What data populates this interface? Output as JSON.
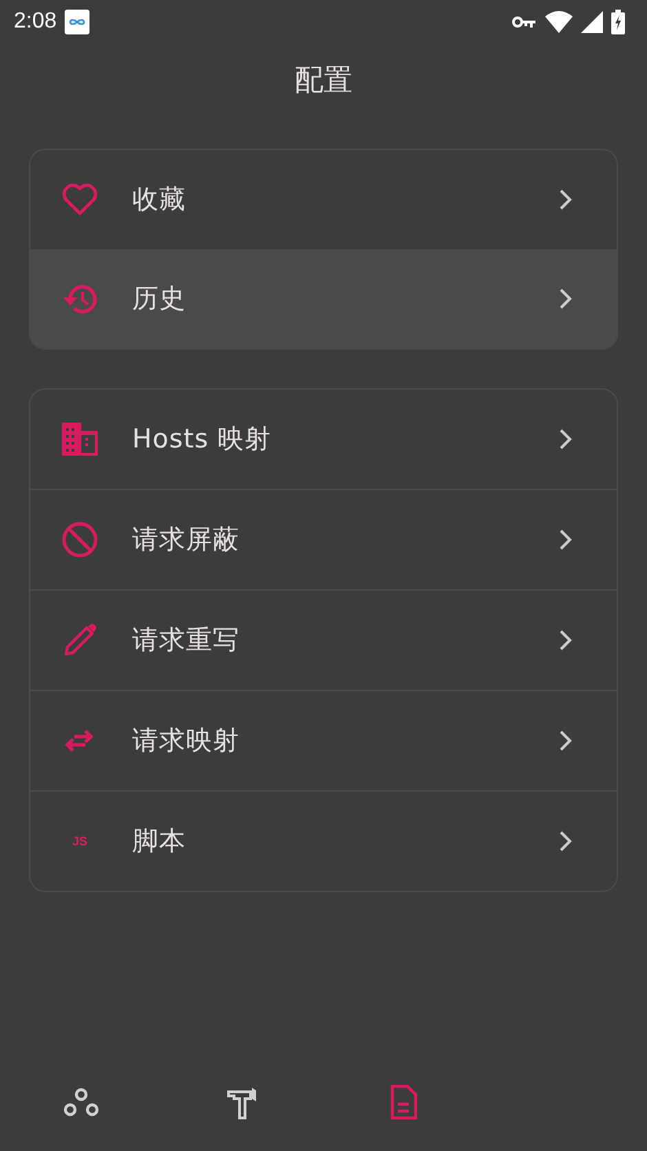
{
  "status_bar": {
    "time": "2:08"
  },
  "title": "配置",
  "groups": [
    {
      "items": [
        {
          "label": "收藏",
          "selected": false
        },
        {
          "label": "历史",
          "selected": true
        }
      ]
    },
    {
      "items": [
        {
          "label": "Hosts 映射",
          "selected": false
        },
        {
          "label": "请求屏蔽",
          "selected": false
        },
        {
          "label": "请求重写",
          "selected": false
        },
        {
          "label": "请求映射",
          "selected": false
        },
        {
          "icon_text": "JS",
          "label": "脚本",
          "selected": false
        }
      ]
    }
  ],
  "bottom_nav": [
    {
      "selected": false
    },
    {
      "selected": false
    },
    {
      "selected": true
    }
  ]
}
